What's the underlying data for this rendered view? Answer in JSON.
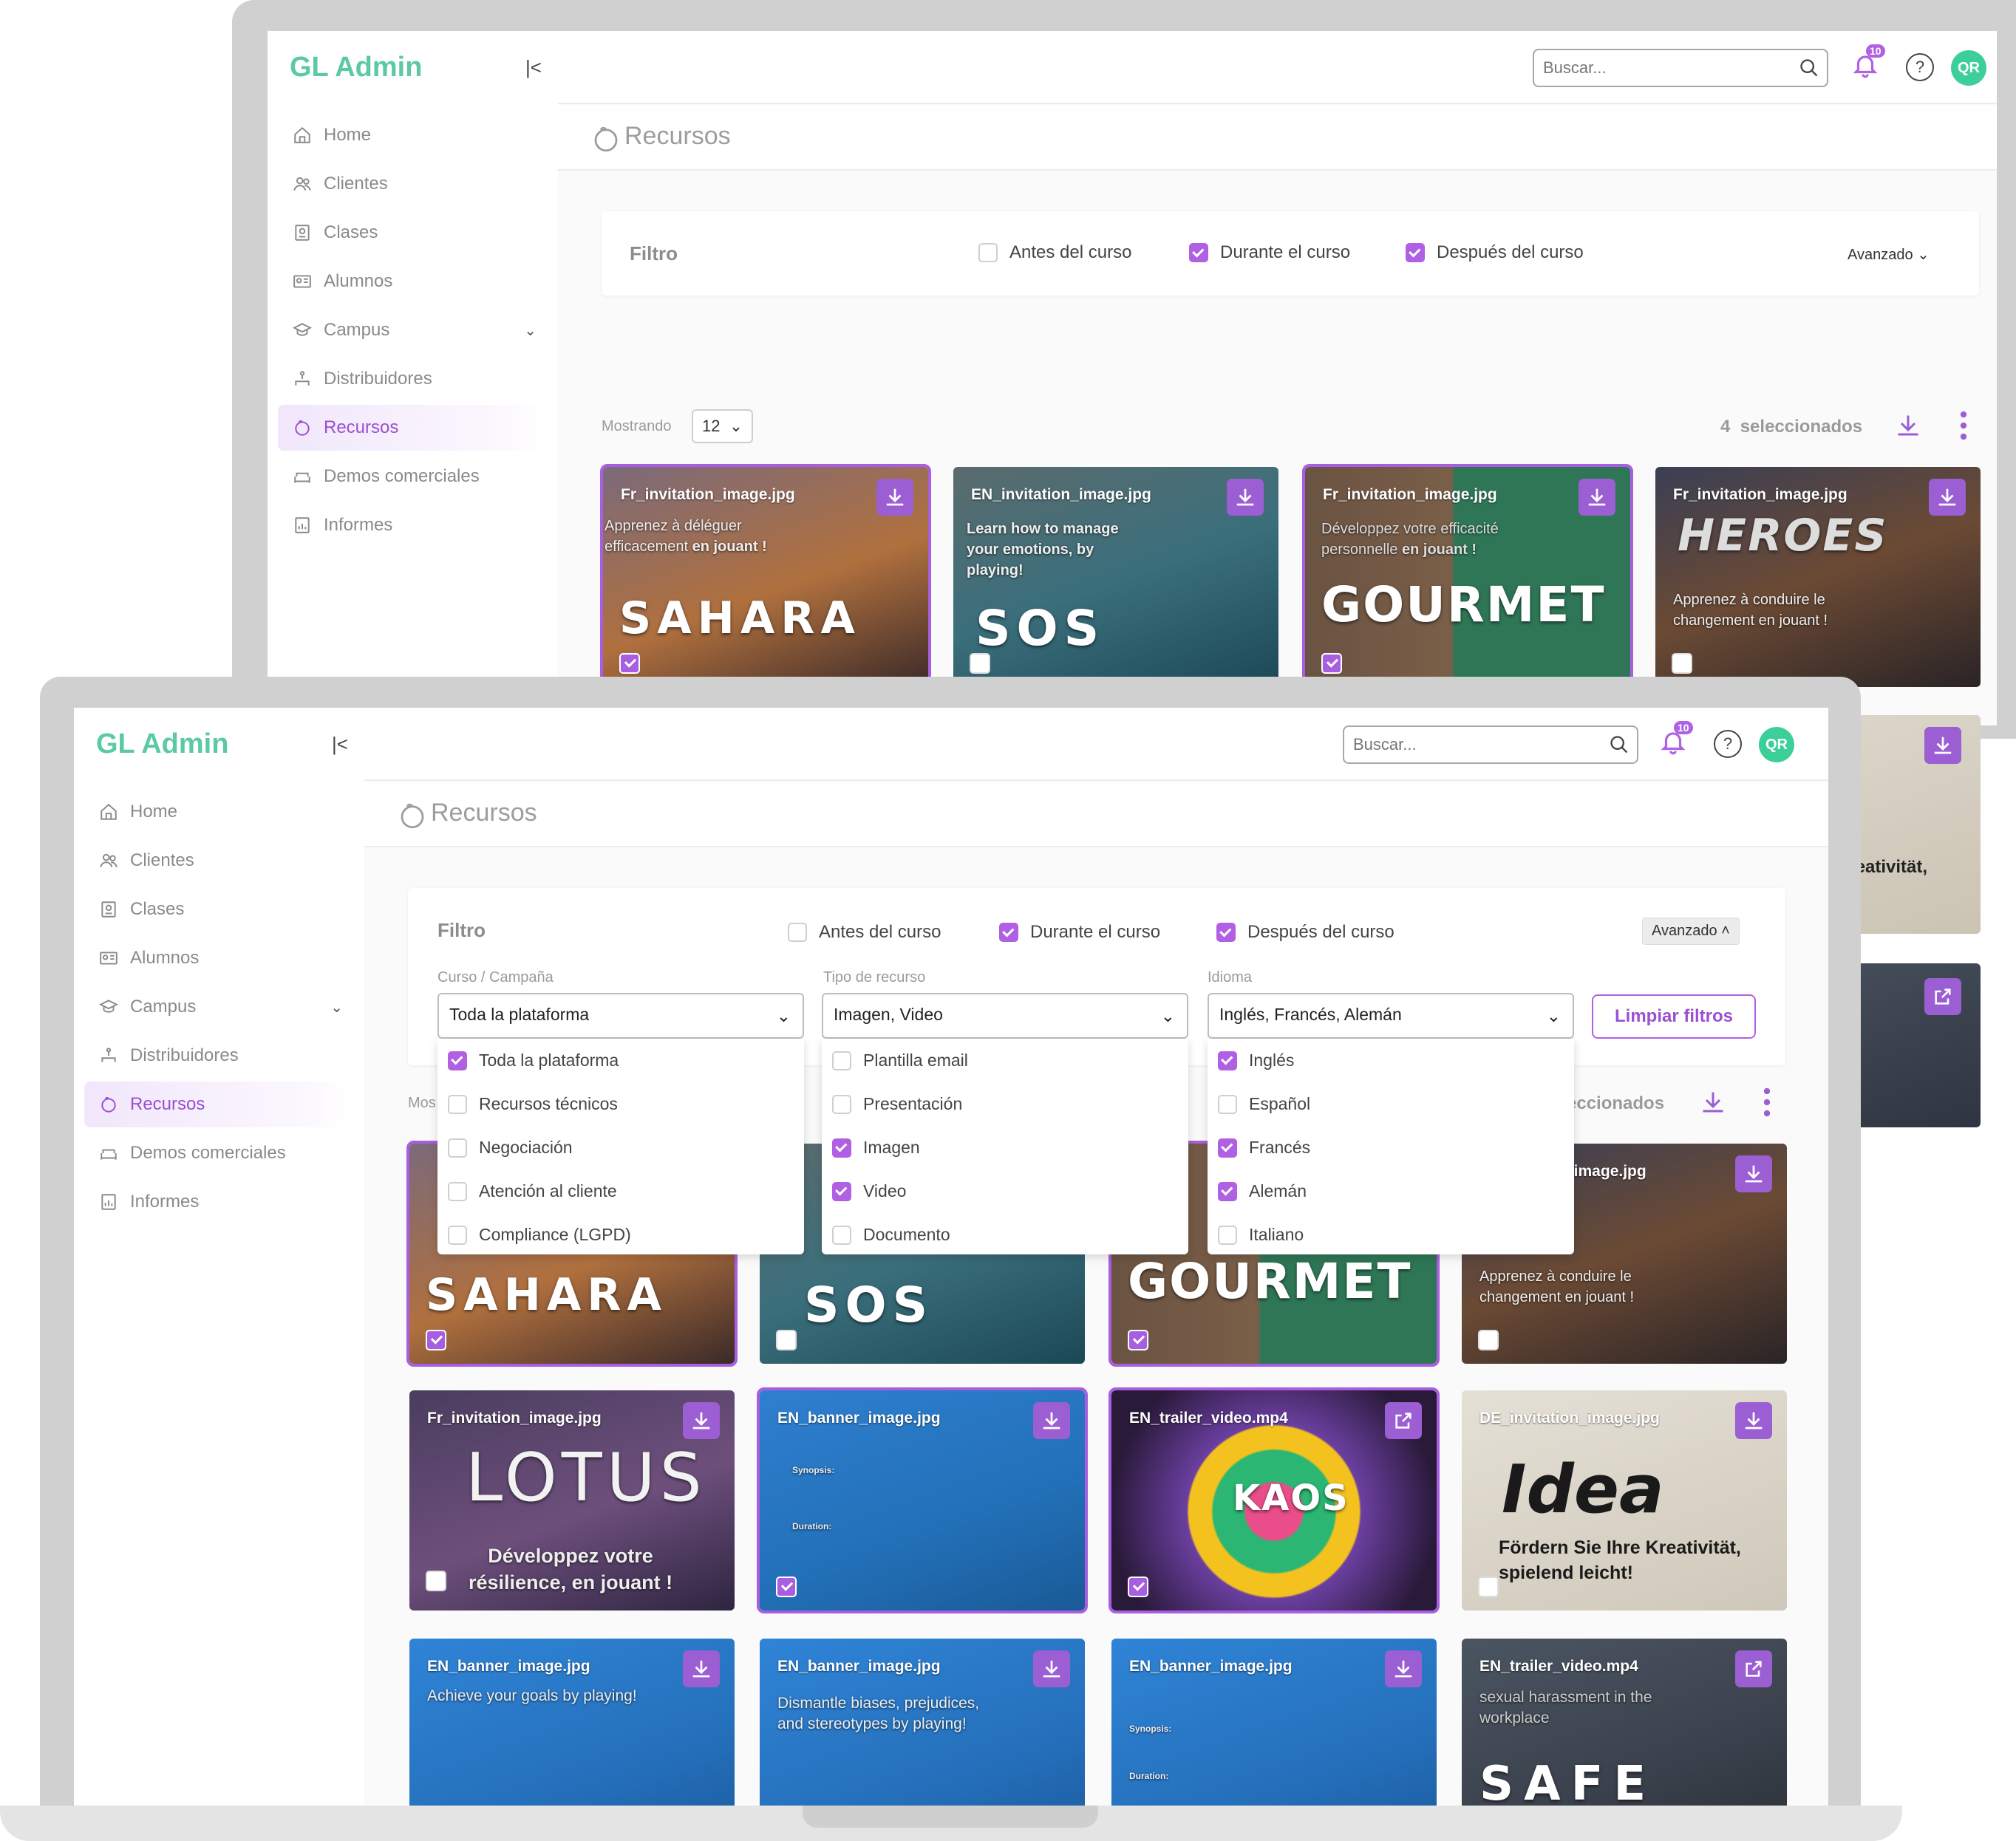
{
  "app": {
    "title": "GL Admin",
    "collapse_icon": "collapse-sidebar-icon"
  },
  "nav": [
    {
      "label": "Home",
      "icon": "home-icon"
    },
    {
      "label": "Clientes",
      "icon": "users-icon"
    },
    {
      "label": "Clases",
      "icon": "class-icon"
    },
    {
      "label": "Alumnos",
      "icon": "student-card-icon"
    },
    {
      "label": "Campus",
      "icon": "graduation-cap-icon"
    },
    {
      "label": "Distribuidores",
      "icon": "network-icon"
    },
    {
      "label": "Recursos",
      "icon": "resources-icon"
    },
    {
      "label": "Demos comerciales",
      "icon": "sofa-icon"
    },
    {
      "label": "Informes",
      "icon": "report-icon"
    }
  ],
  "header": {
    "search_placeholder": "Buscar...",
    "notifications": "10",
    "avatar": "QR"
  },
  "page": {
    "title": "Recursos"
  },
  "filter": {
    "title": "Filtro",
    "antes": "Antes del curso",
    "durante": "Durante el curso",
    "despues": "Después del curso",
    "avanzado": "Avanzado"
  },
  "advanced": {
    "curso_label": "Curso / Campaña",
    "curso_value": "Toda la plataforma",
    "tipo_label": "Tipo de recurso",
    "tipo_value": "Imagen, Video",
    "idioma_label": "Idioma",
    "idioma_value": "Inglés, Francés, Alemán",
    "clear": "Limpiar filtros",
    "curso_options": [
      "Toda la plataforma",
      "Recursos técnicos",
      "Negociación",
      "Atención al cliente",
      "Compliance (LGPD)"
    ],
    "tipo_options": [
      "Plantilla email",
      "Presentación",
      "Imagen",
      "Video",
      "Documento"
    ],
    "idioma_options": [
      "Inglés",
      "Español",
      "Francés",
      "Alemán",
      "Italiano"
    ]
  },
  "list": {
    "showing_label": "Mostrando",
    "page_size": "12",
    "selected_count": "4",
    "selected_label": "seleccionados"
  },
  "cards_row1": [
    {
      "file": "Fr_invitation_image.jpg",
      "text1": "Apprenez à déléguer",
      "text2": "efficacement",
      "text2b": "en jouant !",
      "logo": "SAHARA",
      "selected": true
    },
    {
      "file": "EN_invitation_image.jpg",
      "text1": "Learn how to manage",
      "text2": "your emotions, by",
      "text2b": "playing!",
      "logo": "SOS",
      "selected": false
    },
    {
      "file": "Fr_invitation_image.jpg",
      "text1": "Développez votre efficacité",
      "text2": "personnelle",
      "text2b": "en jouant !",
      "logo": "GOURMET",
      "selected": true
    },
    {
      "file": "Fr_invitation_image.jpg",
      "text1": "Apprenez à conduire le",
      "text2": "changement en jouant !",
      "text2b": "",
      "logo": "HEROES",
      "selected": false
    }
  ],
  "cards_row2": [
    {
      "file": "Fr_invitation_image.jpg",
      "text1": "Développez votre",
      "text2": "résilience, en jouant !",
      "logo": "LOTUS",
      "selected": false
    },
    {
      "file": "EN_banner_image.jpg",
      "text1": "Synopsis:",
      "text2": "Duration:",
      "logo": "",
      "selected": true
    },
    {
      "file": "EN_trailer_video.mp4",
      "text1": "",
      "text2": "",
      "logo": "KAOS",
      "selected": true
    },
    {
      "file": "DE_invitation_image.jpg",
      "text1": "Fördern Sie Ihre Kreativität,",
      "text2": "spielend leicht!",
      "logo": "Idea",
      "selected": false
    }
  ],
  "cards_row3": [
    {
      "file": "EN_banner_image.jpg",
      "text1": "Achieve your goals by playing!"
    },
    {
      "file": "EN_banner_image.jpg",
      "text1": "Dismantle biases, prejudices,",
      "text2": "and stereotypes by playing!"
    },
    {
      "file": "EN_banner_image.jpg",
      "text1": "Synopsis:",
      "text2": "Duration:"
    },
    {
      "file": "EN_trailer_video.mp4",
      "text1": "sexual harassment in the",
      "text2": "workplace",
      "logo": "SAFE"
    }
  ],
  "colors": {
    "accent": "#b061e3",
    "brand": "#5cc9a6"
  }
}
